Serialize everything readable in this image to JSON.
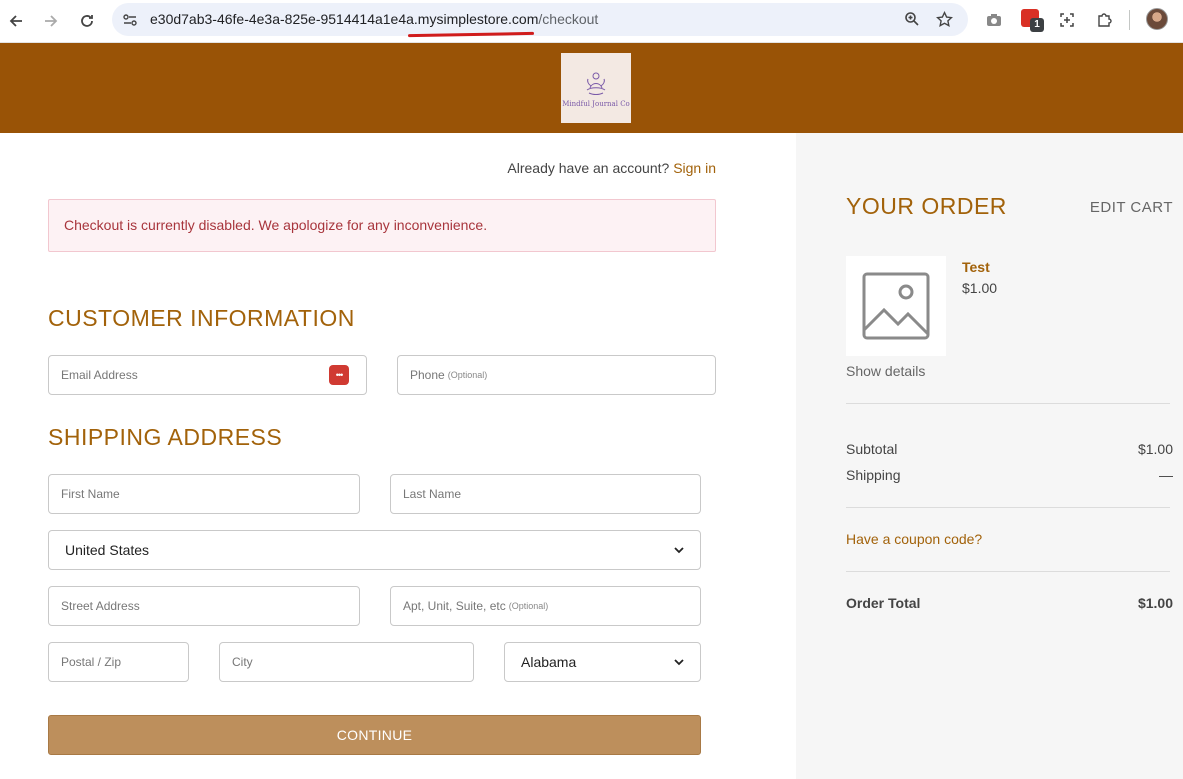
{
  "browser": {
    "url_host": "e30d7ab3-46fe-4e3a-825e-9514414a1e4a.mysimplestore.com",
    "url_path": "/checkout",
    "extension_badge_count": "1"
  },
  "store": {
    "logo_text": "Mindful Journal Co"
  },
  "account": {
    "prompt": "Already have an account?",
    "signin_label": "Sign in"
  },
  "alert": {
    "message": "Checkout is currently disabled. We apologize for any inconvenience."
  },
  "customer": {
    "title": "CUSTOMER INFORMATION",
    "email_placeholder": "Email Address",
    "phone_placeholder": "Phone",
    "phone_optional": "(Optional)"
  },
  "shipping": {
    "title": "SHIPPING ADDRESS",
    "first_name_placeholder": "First Name",
    "last_name_placeholder": "Last Name",
    "country_value": "United States",
    "street_placeholder": "Street Address",
    "apt_placeholder": "Apt, Unit, Suite, etc",
    "apt_optional": "(Optional)",
    "zip_placeholder": "Postal / Zip",
    "city_placeholder": "City",
    "state_value": "Alabama",
    "continue_label": "CONTINUE"
  },
  "order": {
    "title": "YOUR ORDER",
    "edit_cart_label": "EDIT CART",
    "product_name": "Test",
    "product_price": "$1.00",
    "show_details_label": "Show details",
    "subtotal_label": "Subtotal",
    "subtotal_value": "$1.00",
    "shipping_label": "Shipping",
    "shipping_value": "—",
    "coupon_label": "Have a coupon code?",
    "total_label": "Order Total",
    "total_value": "$1.00"
  },
  "colors": {
    "brand_header": "#995306",
    "accent_text": "#a2620a",
    "continue_button": "#bd8f5c",
    "alert_bg": "#fdf2f4",
    "alert_text": "#a8353c"
  }
}
